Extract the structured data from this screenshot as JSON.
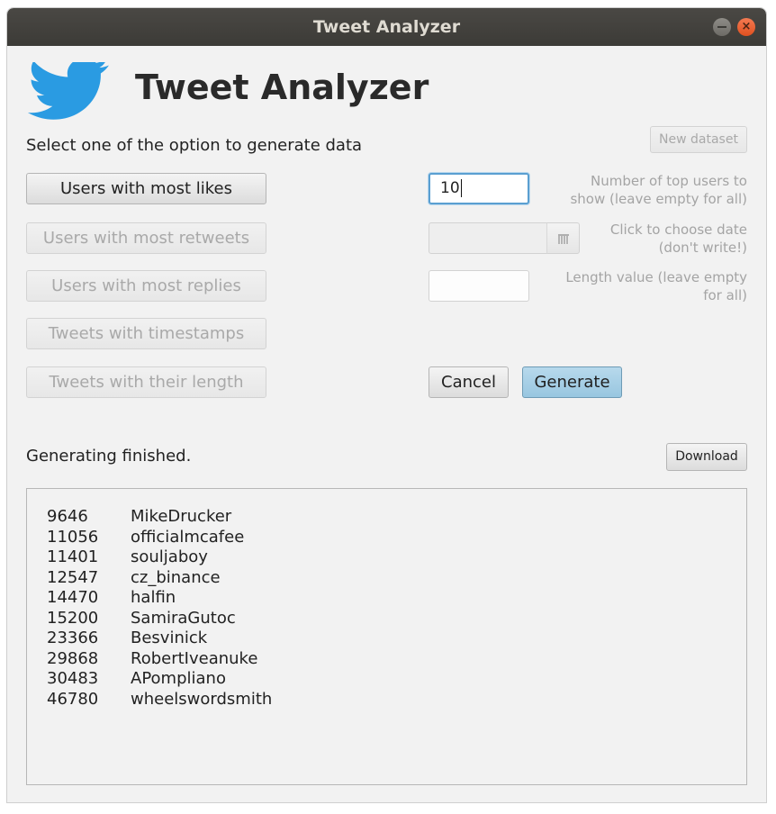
{
  "window": {
    "title": "Tweet Analyzer",
    "close_glyph": "×"
  },
  "header": {
    "logo_icon": "twitter-bird-icon",
    "logo_color": "#2a9be2",
    "title": "Tweet Analyzer"
  },
  "instructions": "Select one of the option to generate data",
  "new_dataset_label": "New dataset",
  "options": [
    {
      "label": "Users with most likes",
      "enabled": true
    },
    {
      "label": "Users with most retweets",
      "enabled": false
    },
    {
      "label": "Users with most replies",
      "enabled": false
    },
    {
      "label": "Tweets with timestamps",
      "enabled": false
    },
    {
      "label": "Tweets with their length",
      "enabled": false
    }
  ],
  "params": {
    "top_users_value": "10",
    "top_users_hint_1": "Number of top users to",
    "top_users_hint_2": "show (leave empty for all)",
    "date_value": "",
    "date_icon": "calendar-icon",
    "date_hint_1": "Click to choose date",
    "date_hint_2": "(don't write!)",
    "length_value": "",
    "length_hint_1": "Length value (leave empty",
    "length_hint_2": "for all)"
  },
  "actions": {
    "cancel_label": "Cancel",
    "generate_label": "Generate",
    "generate_color": "#a9d1e8"
  },
  "status_text": "Generating finished.",
  "download_label": "Download",
  "results": [
    {
      "count": "9646",
      "user": "MikeDrucker"
    },
    {
      "count": "11056",
      "user": "officialmcafee"
    },
    {
      "count": "11401",
      "user": "souljaboy"
    },
    {
      "count": "12547",
      "user": "cz_binance"
    },
    {
      "count": "14470",
      "user": "halfin"
    },
    {
      "count": "15200",
      "user": "SamiraGutoc"
    },
    {
      "count": "23366",
      "user": "Besvinick"
    },
    {
      "count": "29868",
      "user": "RobertIveanuke"
    },
    {
      "count": "30483",
      "user": "APompliano"
    },
    {
      "count": "46780",
      "user": "wheelswordsmith"
    }
  ]
}
